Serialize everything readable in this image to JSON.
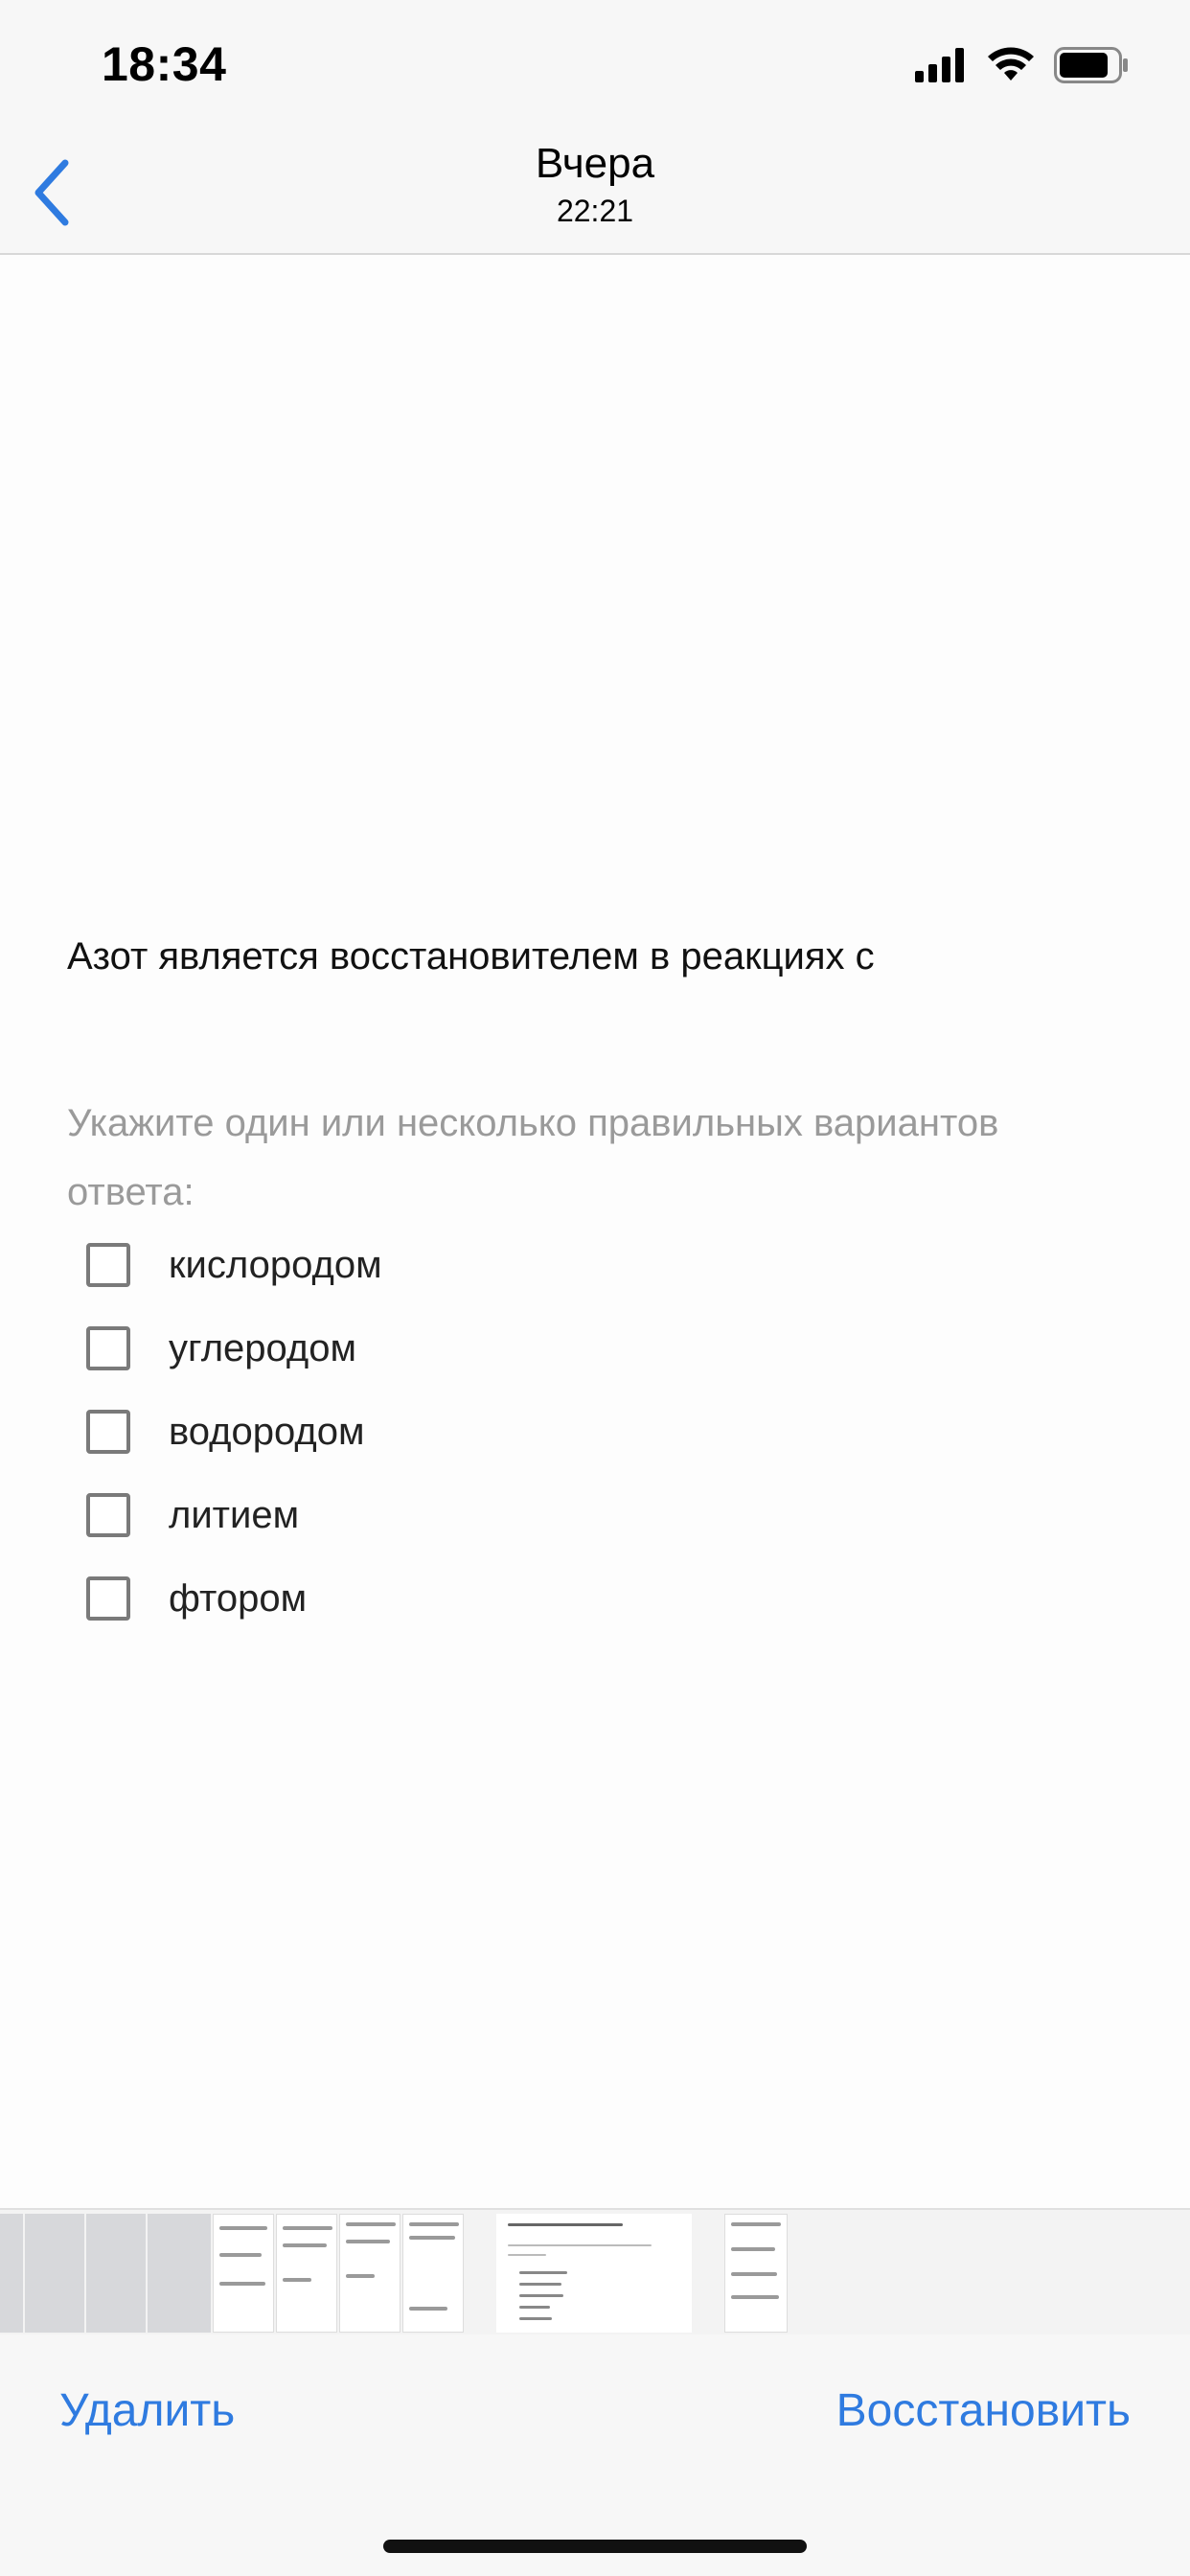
{
  "status_bar": {
    "time": "18:34"
  },
  "nav": {
    "title": "Вчера",
    "subtitle": "22:21"
  },
  "content": {
    "question": "Азот является восстановителем в реакциях с",
    "hint": "Укажите один или несколько правильных вариантов ответа:",
    "options": [
      {
        "label": "кислородом",
        "checked": false
      },
      {
        "label": "углеродом",
        "checked": false
      },
      {
        "label": "водородом",
        "checked": false
      },
      {
        "label": "литием",
        "checked": false
      },
      {
        "label": "фтором",
        "checked": false
      }
    ]
  },
  "toolbar": {
    "delete_label": "Удалить",
    "restore_label": "Восстановить"
  },
  "colors": {
    "accent": "#2f7be0",
    "hint": "#9a9a9a"
  }
}
